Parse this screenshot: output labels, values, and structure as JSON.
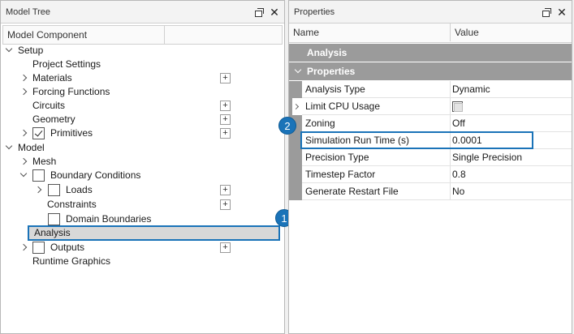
{
  "left_panel": {
    "title": "Model Tree",
    "column_header": "Model Component",
    "tree": [
      {
        "label": "Setup"
      },
      {
        "label": "Project Settings"
      },
      {
        "label": "Materials"
      },
      {
        "label": "Forcing Functions"
      },
      {
        "label": "Circuits"
      },
      {
        "label": "Geometry"
      },
      {
        "label": "Primitives"
      },
      {
        "label": "Model"
      },
      {
        "label": "Mesh"
      },
      {
        "label": "Boundary Conditions"
      },
      {
        "label": "Loads"
      },
      {
        "label": "Constraints"
      },
      {
        "label": "Domain Boundaries"
      },
      {
        "label": "Analysis"
      },
      {
        "label": "Outputs"
      },
      {
        "label": "Runtime Graphics"
      }
    ],
    "add_button_label": "+"
  },
  "right_panel": {
    "title": "Properties",
    "columns": {
      "name": "Name",
      "value": "Value"
    },
    "groups": {
      "analysis": "Analysis",
      "properties": "Properties"
    },
    "rows": [
      {
        "name": "Analysis Type",
        "value": "Dynamic"
      },
      {
        "name": "Limit CPU Usage",
        "value": ""
      },
      {
        "name": "Zoning",
        "value": "Off"
      },
      {
        "name": "Simulation Run Time (s)",
        "value": "0.0001"
      },
      {
        "name": "Precision Type",
        "value": "Single Precision"
      },
      {
        "name": "Timestep Factor",
        "value": "0.8"
      },
      {
        "name": "Generate Restart File",
        "value": "No"
      }
    ]
  },
  "window_buttons": {
    "close": "✕"
  },
  "callouts": {
    "one": "1",
    "two": "2"
  },
  "colors": {
    "accent": "#1a73b8",
    "group_header": "#9b9b9b",
    "selected_row": "#d8d8d8"
  }
}
